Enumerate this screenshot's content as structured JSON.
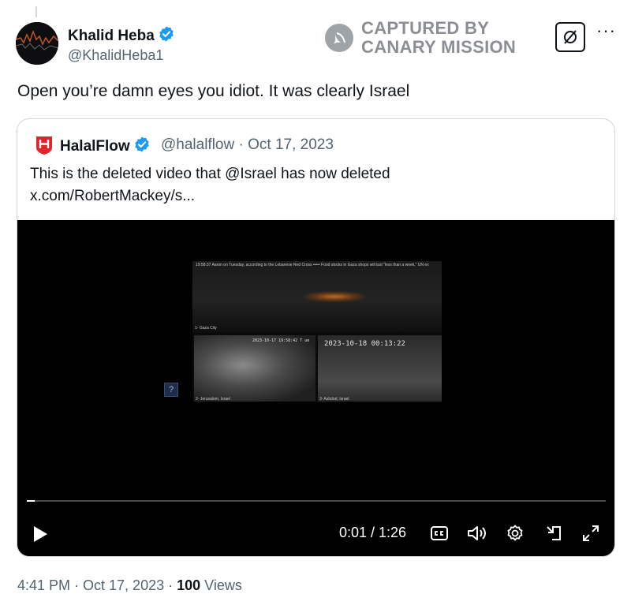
{
  "author": {
    "name": "Khalid Heba",
    "handle": "@KhalidHeba1"
  },
  "watermark": {
    "line1": "CAPTURED BY",
    "line2": "CANARY MISSION"
  },
  "tweet": {
    "text": "Open you’re damn eyes you idiot. It was clearly Israel"
  },
  "quote": {
    "name": "HalalFlow",
    "meta": "@halalflow · Oct 17, 2023",
    "text_line1": "This is the deleted video that @Israel has now deleted",
    "text_line2": "x.com/RobertMackey/s..."
  },
  "video": {
    "ticker": "19:58:37  Aaron on Tuesday, according to the Lebanese Red Cross ••••• Food stocks in Gaza shops will last \"less than a week,\" UN ex",
    "cam1": "1- Gaza City",
    "cam2": "2- Jerusalem, Israel",
    "cam3": "3- Ashdod, Israel",
    "ts_small": "2023-10-17 19:58:42 T ue",
    "ts_large": "2023-10-18 00:13:22",
    "qmark": "?",
    "time": "0:01 / 1:26",
    "progress": 0.013
  },
  "footer": {
    "time": "4:41 PM · Oct 17, 2023 · ",
    "views_count": "100",
    "views_label": " Views"
  },
  "colors": {
    "verified": "#1d9bf0",
    "secondary_text": "#536471",
    "border": "#cfd9de",
    "halalflow_brand": "#e0242b"
  }
}
